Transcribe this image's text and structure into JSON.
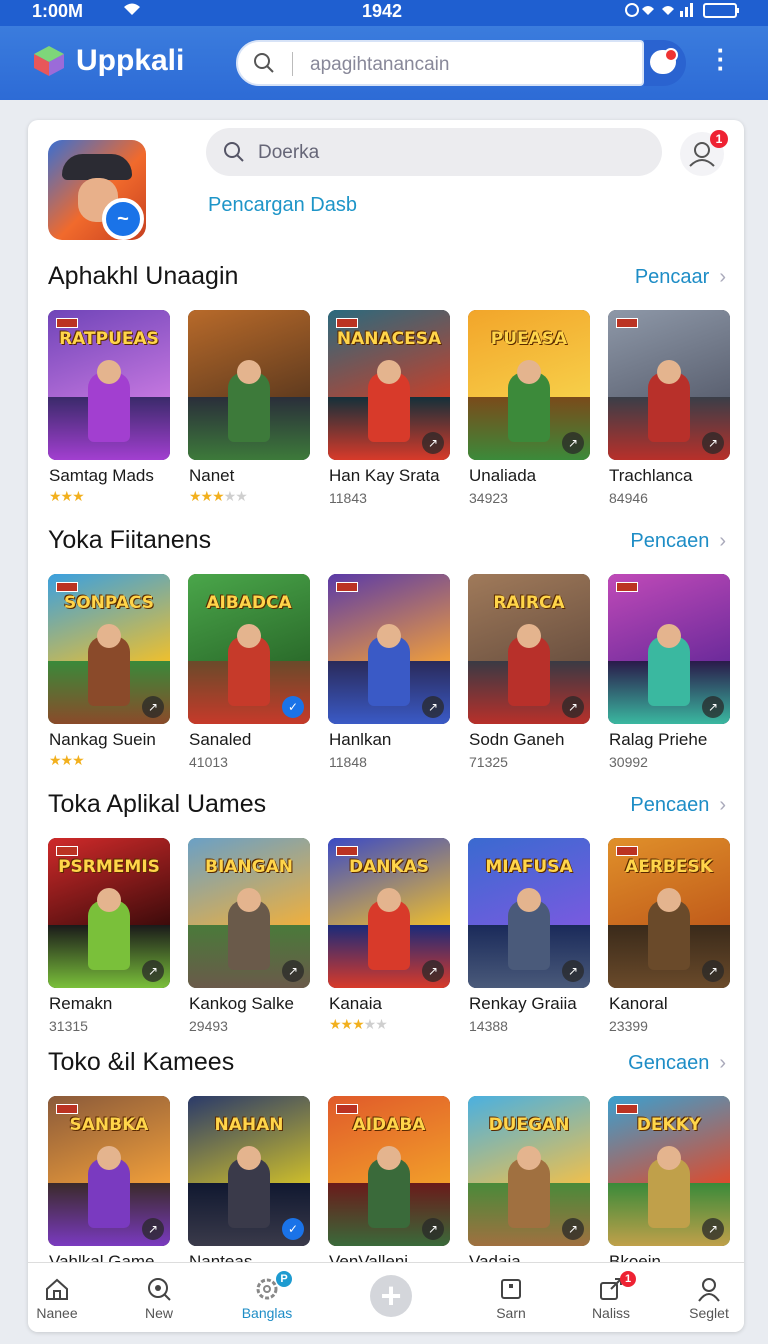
{
  "status_bar": {
    "time": "1:00M",
    "center": "1942",
    "battery": "20"
  },
  "app": {
    "title": "Uppkali",
    "search_placeholder": "apagihtanancain",
    "chat_badge": "0"
  },
  "header": {
    "search_placeholder": "Doerka",
    "profile_badge": "1",
    "sublink": "Pencargan Dasb"
  },
  "colors": {
    "primary": "#2d6bd6",
    "accent": "#1e8dc6",
    "star": "#f2b01e",
    "badge": "#e22233"
  },
  "sections": [
    {
      "title": "Aphakhl Unaagin",
      "more": "Pencaar",
      "items": [
        {
          "name": "Samtag Mads",
          "sub": "",
          "rating": 3,
          "logo": "RATPUEAS",
          "palette": [
            "#6f44b8",
            "#c678e0",
            "#3a2a6a",
            "#a23fd0"
          ]
        },
        {
          "name": "Nanet",
          "sub": "",
          "rating": 3,
          "rating_max": 5,
          "logo": "",
          "palette": [
            "#b86a2a",
            "#5e3a1e",
            "#2a2e3a",
            "#3d7a3a"
          ]
        },
        {
          "name": "Han Kay Srata",
          "sub": "11843",
          "rating": 0,
          "logo": "NANACESA",
          "palette": [
            "#2a6a7e",
            "#c7402a",
            "#14303a",
            "#d83a2a"
          ]
        },
        {
          "name": "Unaliada",
          "sub": "34923",
          "rating": 0,
          "logo": "PUEASA",
          "palette": [
            "#f2a52a",
            "#f7d04a",
            "#7a4a1a",
            "#3c8a3a"
          ]
        },
        {
          "name": "Trachlanca",
          "sub": "84946",
          "rating": 0,
          "logo": "",
          "palette": [
            "#8e98a8",
            "#5a6070",
            "#3a3e48",
            "#b8302a"
          ]
        }
      ]
    },
    {
      "title": "Yoka Fiitanens",
      "more": "Pencaen",
      "items": [
        {
          "name": "Nankag Suein",
          "sub": "",
          "rating": 3,
          "logo": "SONPACS",
          "palette": [
            "#3aa0e0",
            "#f2c02a",
            "#3a8a3a",
            "#8a4a2a"
          ]
        },
        {
          "name": "Sanaled",
          "sub": "41013",
          "rating": 0,
          "logo": "AIBADCA",
          "palette": [
            "#4aa64a",
            "#2a6a2a",
            "#6a4a2a",
            "#c63a2a"
          ]
        },
        {
          "name": "Hanlkan",
          "sub": "11848",
          "rating": 0,
          "logo": "",
          "palette": [
            "#5a3aa8",
            "#f2a03a",
            "#2a2a5a",
            "#3a5ac6"
          ]
        },
        {
          "name": "Sodn Ganeh",
          "sub": "71325",
          "rating": 0,
          "logo": "RAIRCA",
          "palette": [
            "#a07a5a",
            "#6a5040",
            "#3a3a44",
            "#b8302a"
          ]
        },
        {
          "name": "Ralag Priehe",
          "sub": "30992",
          "rating": 0,
          "logo": "",
          "palette": [
            "#c04ab8",
            "#6a2a9a",
            "#2a1a4a",
            "#3ab8a0"
          ]
        }
      ]
    },
    {
      "title": "Toka Aplikal Uames",
      "more": "Pencaen",
      "items": [
        {
          "name": "Remakn",
          "sub": "31315",
          "rating": 0,
          "logo": "PSRMEMIS",
          "palette": [
            "#d02a2a",
            "#3a0a0a",
            "#1a1a1a",
            "#7ac03a"
          ]
        },
        {
          "name": "Kankog Salke",
          "sub": "29493",
          "rating": 0,
          "logo": "BIANGAN",
          "palette": [
            "#6aa0c6",
            "#f2b03a",
            "#4a7a3a",
            "#6a5a4a"
          ]
        },
        {
          "name": "Kanaia",
          "sub": "",
          "rating": 3,
          "rating_max": 5,
          "logo": "DANKAS",
          "palette": [
            "#3a4ac6",
            "#f2c02a",
            "#1a2a7a",
            "#d83a2a"
          ]
        },
        {
          "name": "Renkay Graiia",
          "sub": "14388",
          "rating": 0,
          "logo": "MIAFUSA",
          "palette": [
            "#3a6ad0",
            "#7a5ae0",
            "#1a2a5a",
            "#4a5a7a"
          ]
        },
        {
          "name": "Kanoral",
          "sub": "23399",
          "rating": 0,
          "logo": "AERBESK",
          "palette": [
            "#e0902a",
            "#c05a1a",
            "#3a2a1a",
            "#6a4a2a"
          ]
        }
      ]
    },
    {
      "title": "Toko &il Kamees",
      "more": "Gencaen",
      "items": [
        {
          "name": "Vahlkal Game",
          "sub": "",
          "rating": 0,
          "logo": "SANBKA",
          "palette": [
            "#8a5a3a",
            "#f2a03a",
            "#3a2a2a",
            "#7a3ac0"
          ]
        },
        {
          "name": "Nanteas",
          "sub": "",
          "rating": 0,
          "logo": "NAHAN",
          "palette": [
            "#2a3a6a",
            "#d0c02a",
            "#101830",
            "#3a3a4a"
          ]
        },
        {
          "name": "VenValleni",
          "sub": "",
          "rating": 0,
          "logo": "AIDABA",
          "palette": [
            "#e05a2a",
            "#f2a02a",
            "#6a1a1a",
            "#3a6a3a"
          ]
        },
        {
          "name": "Vadaia",
          "sub": "",
          "rating": 0,
          "logo": "DUEGAN",
          "palette": [
            "#4ab0e0",
            "#f2c04a",
            "#4a8a3a",
            "#a07040"
          ]
        },
        {
          "name": "Bkoein",
          "sub": "",
          "rating": 0,
          "logo": "DEKKY",
          "palette": [
            "#3aa0d0",
            "#e04a2a",
            "#3a8a3a",
            "#c0a04a"
          ]
        }
      ]
    }
  ],
  "bottom_nav": [
    {
      "label": "Nanee",
      "icon": "home-icon",
      "active": false,
      "badge": ""
    },
    {
      "label": "New",
      "icon": "discover-icon",
      "active": false,
      "badge": ""
    },
    {
      "label": "Banglas",
      "icon": "gear-icon",
      "active": true,
      "badge": "P"
    },
    {
      "label": "",
      "icon": "plus-icon",
      "active": false,
      "badge": ""
    },
    {
      "label": "Sarn",
      "icon": "square-icon",
      "active": false,
      "badge": ""
    },
    {
      "label": "Naliss",
      "icon": "share-icon",
      "active": false,
      "badge": "1"
    },
    {
      "label": "Seglet",
      "icon": "person-icon",
      "active": false,
      "badge": ""
    }
  ]
}
